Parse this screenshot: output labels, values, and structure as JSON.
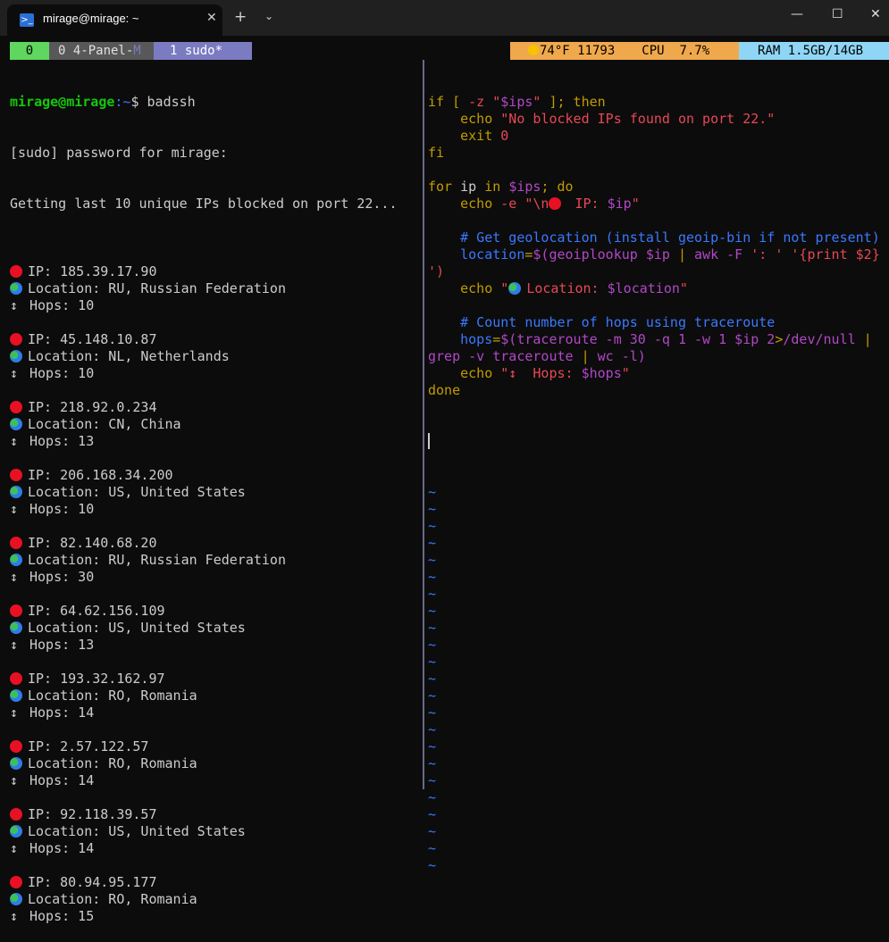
{
  "window": {
    "tab_title": "mirage@mirage: ~",
    "tab_close": "✕",
    "new_tab": "+",
    "dropdown": "⌄",
    "minimize": "—",
    "maximize": "☐",
    "close": "✕"
  },
  "status": {
    "win0": "0",
    "win1": "0 4-Panel-",
    "win1_flag": "M",
    "win2": "1 sudo*",
    "weather": "74°F 11793",
    "cpu": "CPU  7.7%",
    "ram": "RAM 1.5GB/14GB",
    "colors": {
      "green": "#5fd75f",
      "grey": "#585858",
      "purple": "#7b7bc2",
      "orange": "#f0a84c",
      "cyan": "#8fd6f6"
    }
  },
  "left": {
    "prompt_user": "mirage@mirage",
    "prompt_path": ":~",
    "prompt_sym": "$ ",
    "command": "badssh",
    "sudo_line": "[sudo] password for mirage:",
    "intro": "Getting last 10 unique IPs blocked on port 22...",
    "arrow_glyph": "↕",
    "entries": [
      {
        "ip": "IP: 185.39.17.90",
        "loc": "Location: RU, Russian Federation",
        "hops": "Hops: 10"
      },
      {
        "ip": "IP: 45.148.10.87",
        "loc": "Location: NL, Netherlands",
        "hops": "Hops: 10"
      },
      {
        "ip": "IP: 218.92.0.234",
        "loc": "Location: CN, China",
        "hops": "Hops: 13"
      },
      {
        "ip": "IP: 206.168.34.200",
        "loc": "Location: US, United States",
        "hops": "Hops: 10"
      },
      {
        "ip": "IP: 82.140.68.20",
        "loc": "Location: RU, Russian Federation",
        "hops": "Hops: 30"
      },
      {
        "ip": "IP: 64.62.156.109",
        "loc": "Location: US, United States",
        "hops": "Hops: 13"
      },
      {
        "ip": "IP: 193.32.162.97",
        "loc": "Location: RO, Romania",
        "hops": "Hops: 14"
      },
      {
        "ip": "IP: 2.57.122.57",
        "loc": "Location: RO, Romania",
        "hops": "Hops: 14"
      },
      {
        "ip": "IP: 92.118.39.57",
        "loc": "Location: US, United States",
        "hops": "Hops: 14"
      },
      {
        "ip": "IP: 80.94.95.177",
        "loc": "Location: RO, Romania",
        "hops": "Hops: 15"
      }
    ]
  },
  "right": {
    "code": [
      [
        [
          "yel",
          "if [ "
        ],
        [
          "red",
          "-z "
        ],
        [
          "red",
          "\""
        ],
        [
          "mag",
          "$ips"
        ],
        [
          "red",
          "\""
        ],
        [
          "yel",
          " ]; then"
        ]
      ],
      [
        [
          "yel",
          "    echo "
        ],
        [
          "red",
          "\"No blocked IPs found on port 22.\""
        ]
      ],
      [
        [
          "yel",
          "    exit "
        ],
        [
          "red",
          "0"
        ]
      ],
      [
        [
          "yel",
          "fi"
        ]
      ],
      [],
      [
        [
          "yel",
          "for "
        ],
        [
          "",
          "ip"
        ],
        [
          "yel",
          " in "
        ],
        [
          "mag",
          "$ips"
        ],
        [
          "yel",
          "; do"
        ]
      ],
      [
        [
          "yel",
          "    echo "
        ],
        [
          "red",
          "-e "
        ],
        [
          "red",
          "\"\\n"
        ],
        [
          "DOT",
          ""
        ],
        [
          "red",
          " IP: "
        ],
        [
          "mag",
          "$ip"
        ],
        [
          "red",
          "\""
        ]
      ],
      [],
      [
        [
          "cmt",
          "    # Get geolocation (install geoip-bin if not present)"
        ]
      ],
      [
        [
          "blue",
          "    location"
        ],
        [
          "yel",
          "="
        ],
        [
          "mag",
          "$(geoiplookup $ip "
        ],
        [
          "yel",
          "| "
        ],
        [
          "mag",
          "awk -F "
        ],
        [
          "red",
          "': '"
        ],
        [
          "mag",
          " "
        ],
        [
          "red",
          "'{print $2}"
        ]
      ],
      [
        [
          "red",
          "')"
        ]
      ],
      [
        [
          "yel",
          "    echo "
        ],
        [
          "red",
          "\""
        ],
        [
          "GLOBE",
          ""
        ],
        [
          "red",
          "Location: "
        ],
        [
          "mag",
          "$location"
        ],
        [
          "red",
          "\""
        ]
      ],
      [],
      [
        [
          "cmt",
          "    # Count number of hops using traceroute"
        ]
      ],
      [
        [
          "blue",
          "    hops"
        ],
        [
          "yel",
          "="
        ],
        [
          "mag",
          "$(traceroute -m 30 -q 1 -w 1 $ip 2"
        ],
        [
          "yel",
          ">"
        ],
        [
          "mag",
          "/dev/null "
        ],
        [
          "yel",
          "|"
        ]
      ],
      [
        [
          "mag",
          "grep -v traceroute "
        ],
        [
          "yel",
          "| "
        ],
        [
          "mag",
          "wc -l)"
        ]
      ],
      [
        [
          "yel",
          "    echo "
        ],
        [
          "red",
          "\"↕  Hops: "
        ],
        [
          "mag",
          "$hops"
        ],
        [
          "red",
          "\""
        ]
      ],
      [
        [
          "yel",
          "done"
        ]
      ]
    ],
    "tilde": "~",
    "tilde_count": 23
  }
}
